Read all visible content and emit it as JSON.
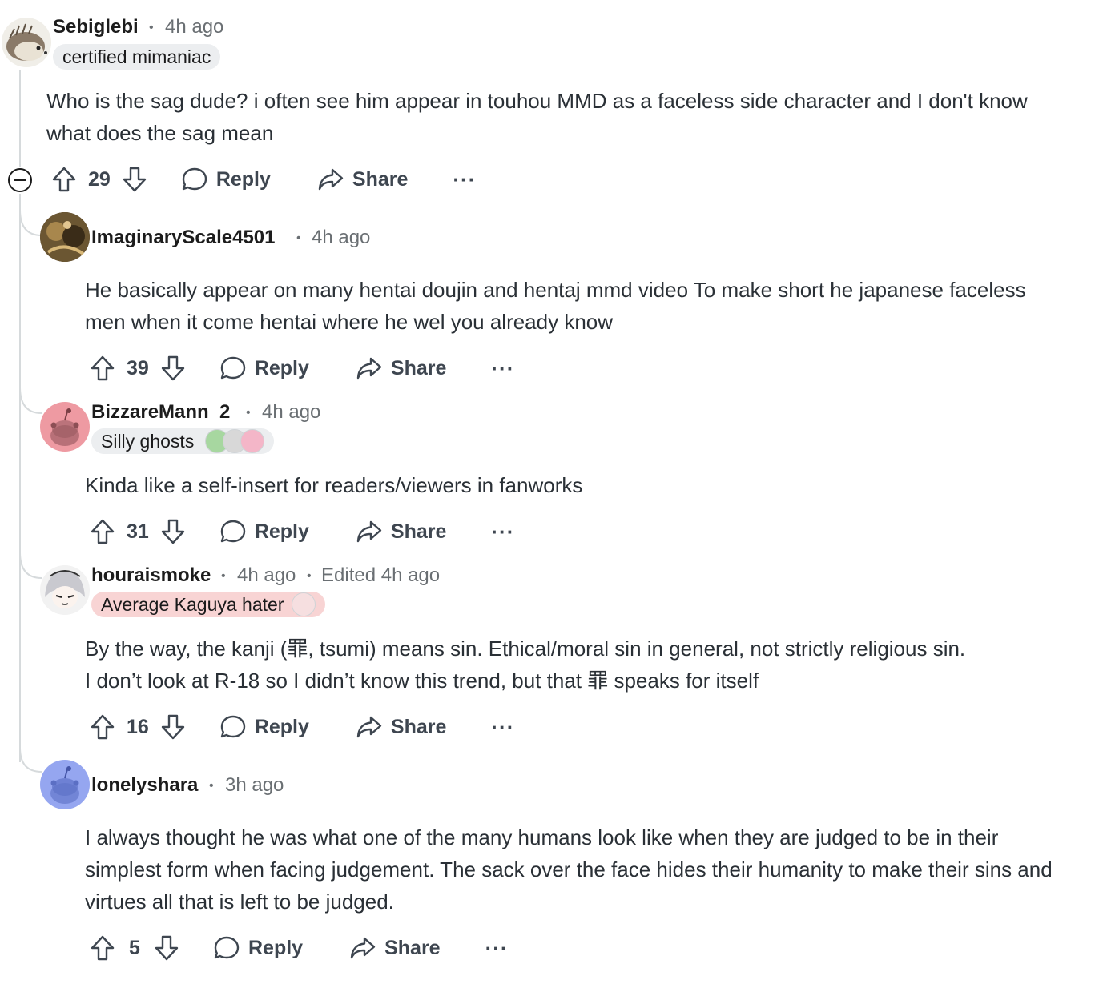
{
  "comments": [
    {
      "username": "Sebiglebi",
      "time": "4h ago",
      "flair": "certified mimaniac",
      "body": "Who is the sag dude? i often see him appear in touhou MMD as a faceless side character and I don't know what does the sag mean",
      "score": "29",
      "reply_label": "Reply",
      "share_label": "Share",
      "more_label": "···",
      "avatar_icon": "hedgehog-avatar",
      "collapse_icon": "collapse-minus-icon"
    },
    {
      "username": "ImaginaryScale4501",
      "time": "4h ago",
      "body": "He basically appear on many hentai doujin and hentaj mmd video  To make short he japanese faceless men when it come hentai where he wel you already know",
      "score": "39",
      "reply_label": "Reply",
      "share_label": "Share",
      "more_label": "···",
      "avatar_icon": "custom-avatar"
    },
    {
      "username": "BizzareMann_2",
      "time": "4h ago",
      "flair": "Silly ghosts",
      "body": "Kinda like a self-insert for readers/viewers in fanworks",
      "score": "31",
      "reply_label": "Reply",
      "share_label": "Share",
      "more_label": "···",
      "avatar_icon": "snoo-avatar",
      "avatar_color": "#ee9aa2"
    },
    {
      "username": "houraismoke",
      "time": "4h ago",
      "edited": "Edited 4h ago",
      "flair": "Average Kaguya hater",
      "flair_color": "#f8d4d4",
      "body_line1": "By the way, the kanji (罪, tsumi) means sin. Ethical/moral sin in general, not strictly religious sin.",
      "body_line2": "I don’t look at R-18 so I didn’t know this trend, but that 罪 speaks for itself",
      "score": "16",
      "reply_label": "Reply",
      "share_label": "Share",
      "more_label": "···",
      "avatar_icon": "anime-avatar"
    },
    {
      "username": "lonelyshara",
      "time": "3h ago",
      "body": "I always thought he was what one of the many humans look like when they are judged to be in their simplest form when facing judgement. The sack over the face hides their humanity to make their sins and virtues all that is left to be judged.",
      "score": "5",
      "reply_label": "Reply",
      "share_label": "Share",
      "more_label": "···",
      "avatar_icon": "snoo-avatar",
      "avatar_color": "#95a6f0"
    }
  ],
  "separator": "•"
}
